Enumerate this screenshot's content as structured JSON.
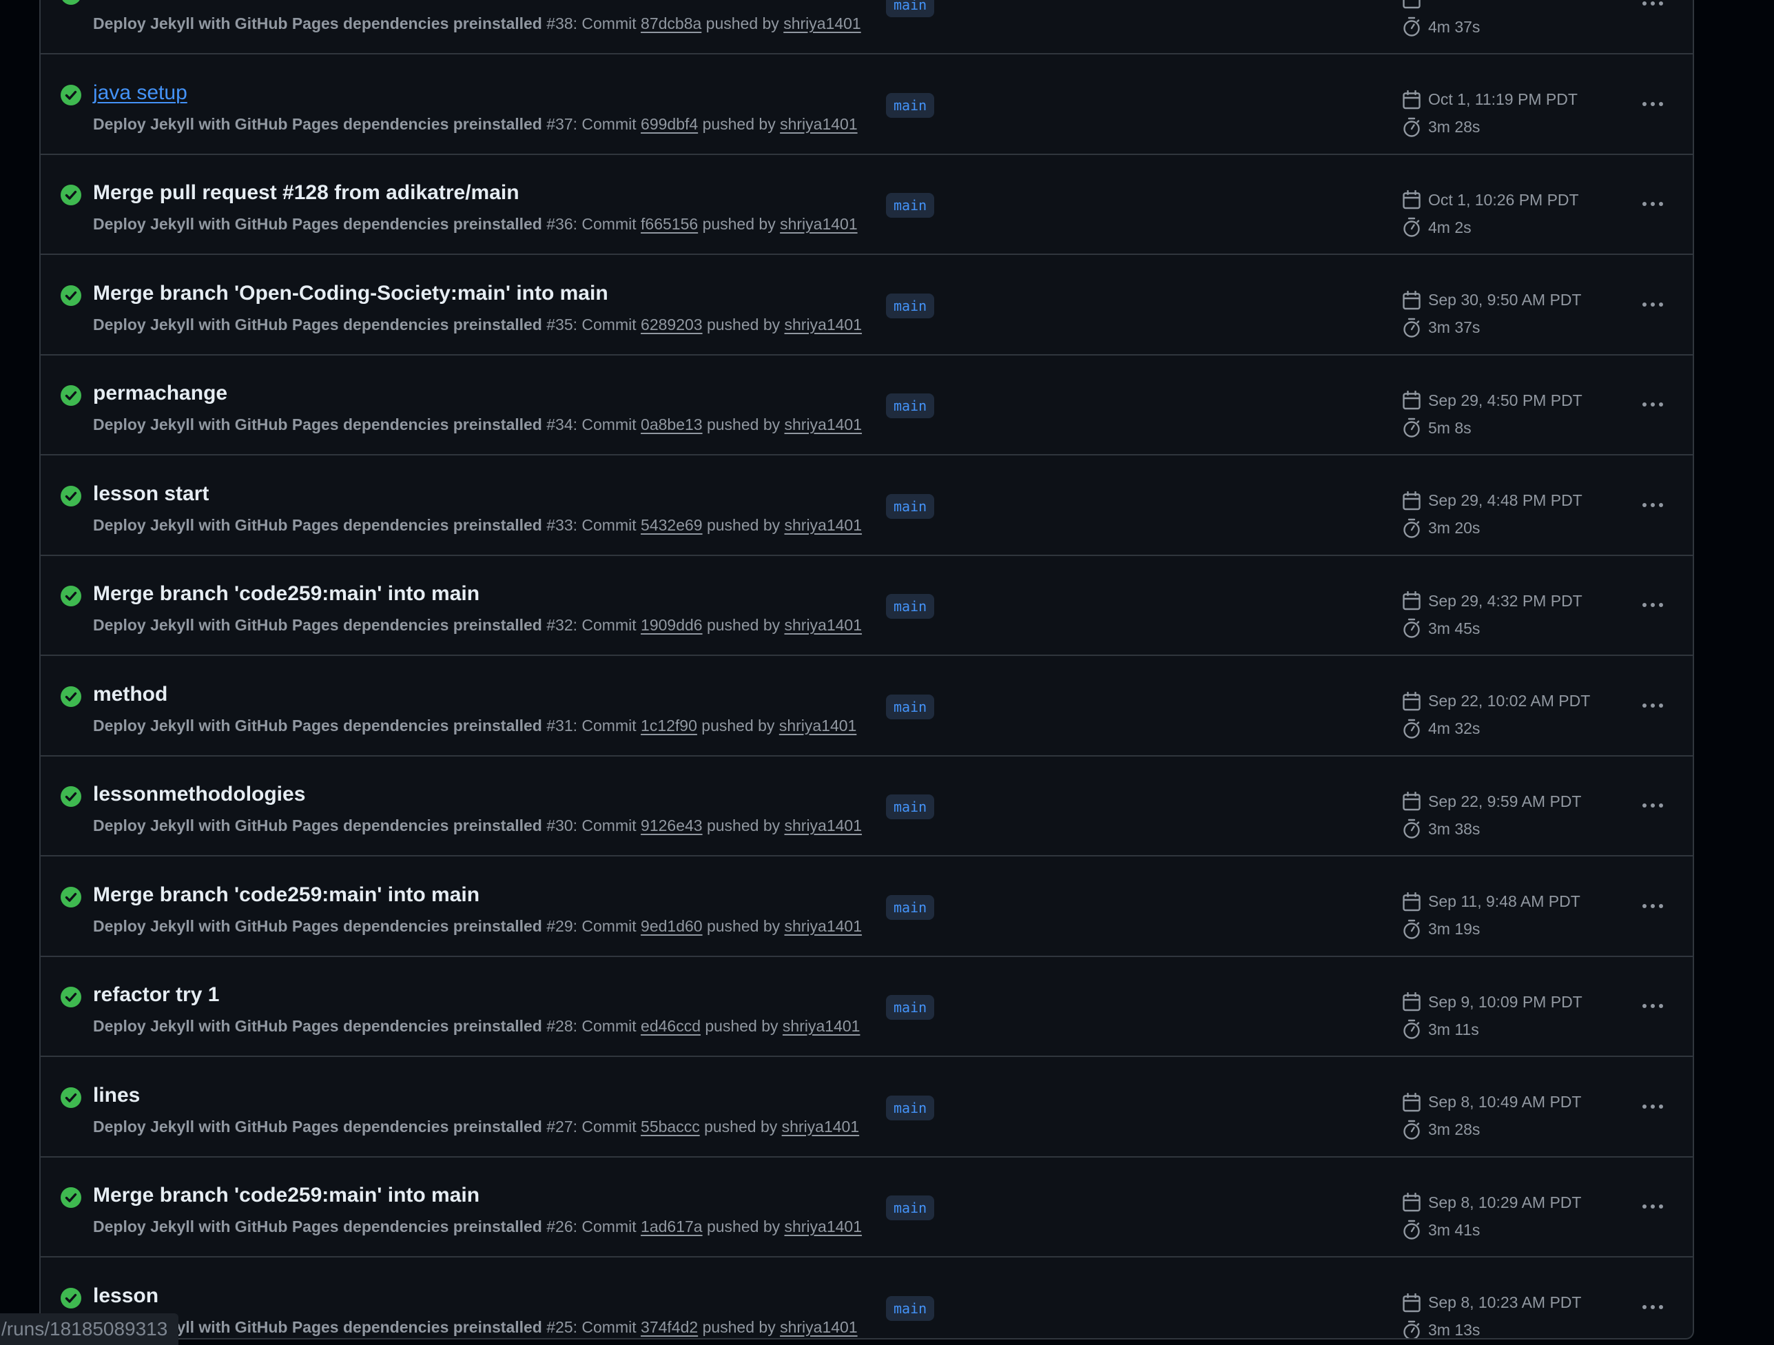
{
  "colors": {
    "background": "#010409",
    "panel": "#0d1117",
    "border": "#30363d",
    "success": "#3fb950",
    "link": "#4493f8",
    "muted": "#9198a1",
    "title": "#e6edf3",
    "branch_bg": "#1f2b3d"
  },
  "icons": {
    "status": "check-circle-fill-icon",
    "date": "calendar-icon",
    "duration": "stopwatch-icon",
    "menu": "kebab-horizontal-icon"
  },
  "labels": {
    "commit_word": "Commit",
    "pushed_by": "pushed by"
  },
  "runs": [
    {
      "title": "",
      "workflow": "Deploy Jekyll with GitHub Pages dependencies preinstalled",
      "number": "#38:",
      "commit": "87dcb8a",
      "author": "shriya1401",
      "branch": "main",
      "date": "",
      "duration": "4m 37s",
      "is_link": false
    },
    {
      "title": "java setup",
      "workflow": "Deploy Jekyll with GitHub Pages dependencies preinstalled",
      "number": "#37:",
      "commit": "699dbf4",
      "author": "shriya1401",
      "branch": "main",
      "date": "Oct 1, 11:19 PM PDT",
      "duration": "3m 28s",
      "is_link": true
    },
    {
      "title": "Merge pull request #128 from adikatre/main",
      "workflow": "Deploy Jekyll with GitHub Pages dependencies preinstalled",
      "number": "#36:",
      "commit": "f665156",
      "author": "shriya1401",
      "branch": "main",
      "date": "Oct 1, 10:26 PM PDT",
      "duration": "4m 2s",
      "is_link": false
    },
    {
      "title": "Merge branch 'Open-Coding-Society:main' into main",
      "workflow": "Deploy Jekyll with GitHub Pages dependencies preinstalled",
      "number": "#35:",
      "commit": "6289203",
      "author": "shriya1401",
      "branch": "main",
      "date": "Sep 30, 9:50 AM PDT",
      "duration": "3m 37s",
      "is_link": false
    },
    {
      "title": "permachange",
      "workflow": "Deploy Jekyll with GitHub Pages dependencies preinstalled",
      "number": "#34:",
      "commit": "0a8be13",
      "author": "shriya1401",
      "branch": "main",
      "date": "Sep 29, 4:50 PM PDT",
      "duration": "5m 8s",
      "is_link": false
    },
    {
      "title": "lesson start",
      "workflow": "Deploy Jekyll with GitHub Pages dependencies preinstalled",
      "number": "#33:",
      "commit": "5432e69",
      "author": "shriya1401",
      "branch": "main",
      "date": "Sep 29, 4:48 PM PDT",
      "duration": "3m 20s",
      "is_link": false
    },
    {
      "title": "Merge branch 'code259:main' into main",
      "workflow": "Deploy Jekyll with GitHub Pages dependencies preinstalled",
      "number": "#32:",
      "commit": "1909dd6",
      "author": "shriya1401",
      "branch": "main",
      "date": "Sep 29, 4:32 PM PDT",
      "duration": "3m 45s",
      "is_link": false
    },
    {
      "title": "method",
      "workflow": "Deploy Jekyll with GitHub Pages dependencies preinstalled",
      "number": "#31:",
      "commit": "1c12f90",
      "author": "shriya1401",
      "branch": "main",
      "date": "Sep 22, 10:02 AM PDT",
      "duration": "4m 32s",
      "is_link": false
    },
    {
      "title": "lessonmethodologies",
      "workflow": "Deploy Jekyll with GitHub Pages dependencies preinstalled",
      "number": "#30:",
      "commit": "9126e43",
      "author": "shriya1401",
      "branch": "main",
      "date": "Sep 22, 9:59 AM PDT",
      "duration": "3m 38s",
      "is_link": false
    },
    {
      "title": "Merge branch 'code259:main' into main",
      "workflow": "Deploy Jekyll with GitHub Pages dependencies preinstalled",
      "number": "#29:",
      "commit": "9ed1d60",
      "author": "shriya1401",
      "branch": "main",
      "date": "Sep 11, 9:48 AM PDT",
      "duration": "3m 19s",
      "is_link": false
    },
    {
      "title": "refactor try 1",
      "workflow": "Deploy Jekyll with GitHub Pages dependencies preinstalled",
      "number": "#28:",
      "commit": "ed46ccd",
      "author": "shriya1401",
      "branch": "main",
      "date": "Sep 9, 10:09 PM PDT",
      "duration": "3m 11s",
      "is_link": false
    },
    {
      "title": "lines",
      "workflow": "Deploy Jekyll with GitHub Pages dependencies preinstalled",
      "number": "#27:",
      "commit": "55baccc",
      "author": "shriya1401",
      "branch": "main",
      "date": "Sep 8, 10:49 AM PDT",
      "duration": "3m 28s",
      "is_link": false
    },
    {
      "title": "Merge branch 'code259:main' into main",
      "workflow": "Deploy Jekyll with GitHub Pages dependencies preinstalled",
      "number": "#26:",
      "commit": "1ad617a",
      "author": "shriya1401",
      "branch": "main",
      "date": "Sep 8, 10:29 AM PDT",
      "duration": "3m 41s",
      "is_link": false
    },
    {
      "title": "lesson",
      "workflow": "Deploy Jekyll with GitHub Pages dependencies preinstalled",
      "number": "#25:",
      "commit": "374f4d2",
      "author": "shriya1401",
      "branch": "main",
      "date": "Sep 8, 10:23 AM PDT",
      "duration": "3m 13s",
      "is_link": false
    }
  ],
  "status_bar": {
    "url": "/runs/18185089313"
  }
}
